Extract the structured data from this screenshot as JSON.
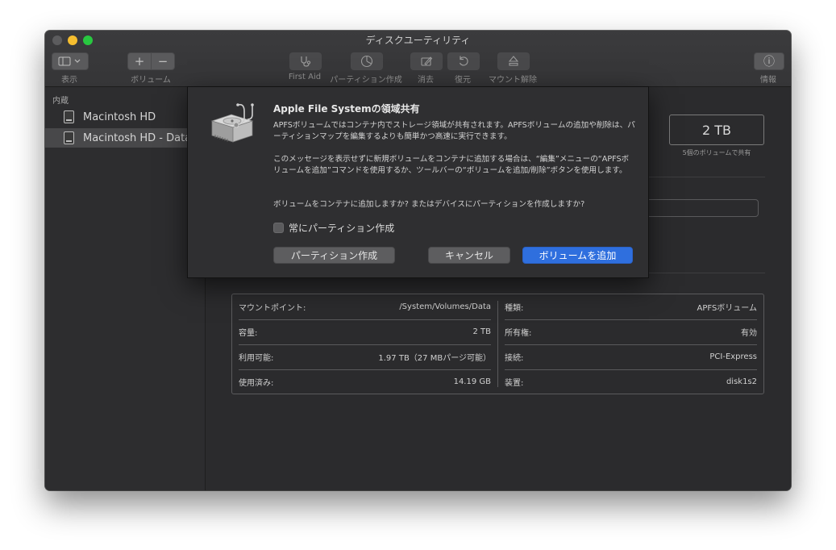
{
  "window": {
    "title": "ディスクユーティリティ"
  },
  "toolbar": {
    "view_label": "表示",
    "volume_label": "ボリューム",
    "first_aid_label": "First Aid",
    "partition_label": "パーティション作成",
    "erase_label": "消去",
    "restore_label": "復元",
    "unmount_label": "マウント解除",
    "info_label": "情報",
    "add_symbol": "+",
    "remove_symbol": "−",
    "info_symbol": "ⓘ"
  },
  "sidebar": {
    "section": "内蔵",
    "items": [
      {
        "label": "Macintosh HD",
        "selected": false
      },
      {
        "label": "Macintosh HD - Data",
        "selected": true
      }
    ]
  },
  "capacity": {
    "value": "2 TB",
    "subtitle": "5個のボリュームで共有"
  },
  "info": {
    "left": [
      {
        "key": "マウントポイント:",
        "value": "/System/Volumes/Data"
      },
      {
        "key": "容量:",
        "value": "2 TB"
      },
      {
        "key": "利用可能:",
        "value": "1.97 TB（27 MBパージ可能）"
      },
      {
        "key": "使用済み:",
        "value": "14.19 GB"
      }
    ],
    "right": [
      {
        "key": "種類:",
        "value": "APFSボリューム"
      },
      {
        "key": "所有権:",
        "value": "有効"
      },
      {
        "key": "接続:",
        "value": "PCI-Express"
      },
      {
        "key": "装置:",
        "value": "disk1s2"
      }
    ]
  },
  "dialog": {
    "title": "Apple File Systemの領域共有",
    "paragraph1": "APFSボリュームではコンテナ内でストレージ領域が共有されます。APFSボリュームの追加や削除は、パーティションマップを編集するよりも簡単かつ高速に実行できます。",
    "paragraph2": "このメッセージを表示せずに新規ボリュームをコンテナに追加する場合は、“編集”メニューの“APFSボリュームを追加”コマンドを使用するか、ツールバーの“ボリュームを追加/削除”ボタンを使用します。",
    "paragraph3": "ボリュームをコンテナに追加しますか? またはデバイスにパーティションを作成しますか?",
    "checkbox_label": "常にパーティション作成",
    "checkbox_checked": false,
    "partition_button": "パーティション作成",
    "cancel_button": "キャンセル",
    "add_volume_button": "ボリュームを追加"
  },
  "colors": {
    "accent": "#2f6fde",
    "window_bg": "#2b2b2d"
  }
}
